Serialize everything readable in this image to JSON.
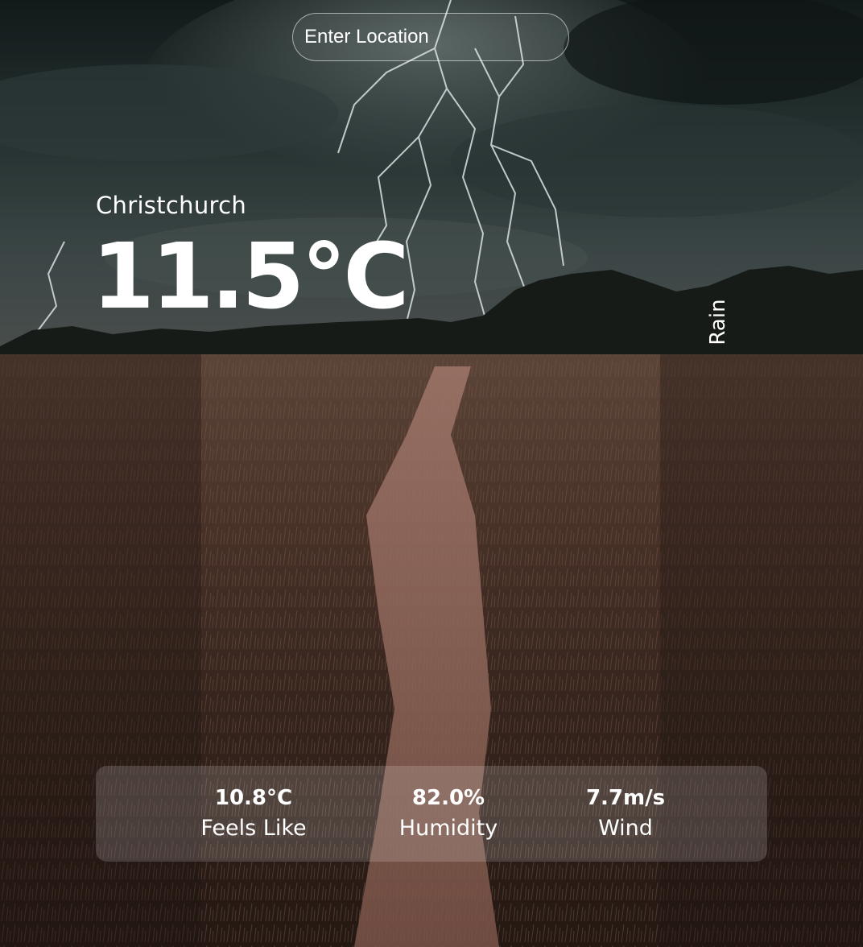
{
  "search": {
    "placeholder": "Enter Location"
  },
  "weather": {
    "city": "Christchurch",
    "temperature": "11.5°C",
    "condition": "Rain"
  },
  "stats": {
    "feels_like": {
      "value": "10.8°C",
      "label": "Feels Like"
    },
    "humidity": {
      "value": "82.0%",
      "label": "Humidity"
    },
    "wind": {
      "value": "7.7m/s",
      "label": "Wind"
    }
  }
}
